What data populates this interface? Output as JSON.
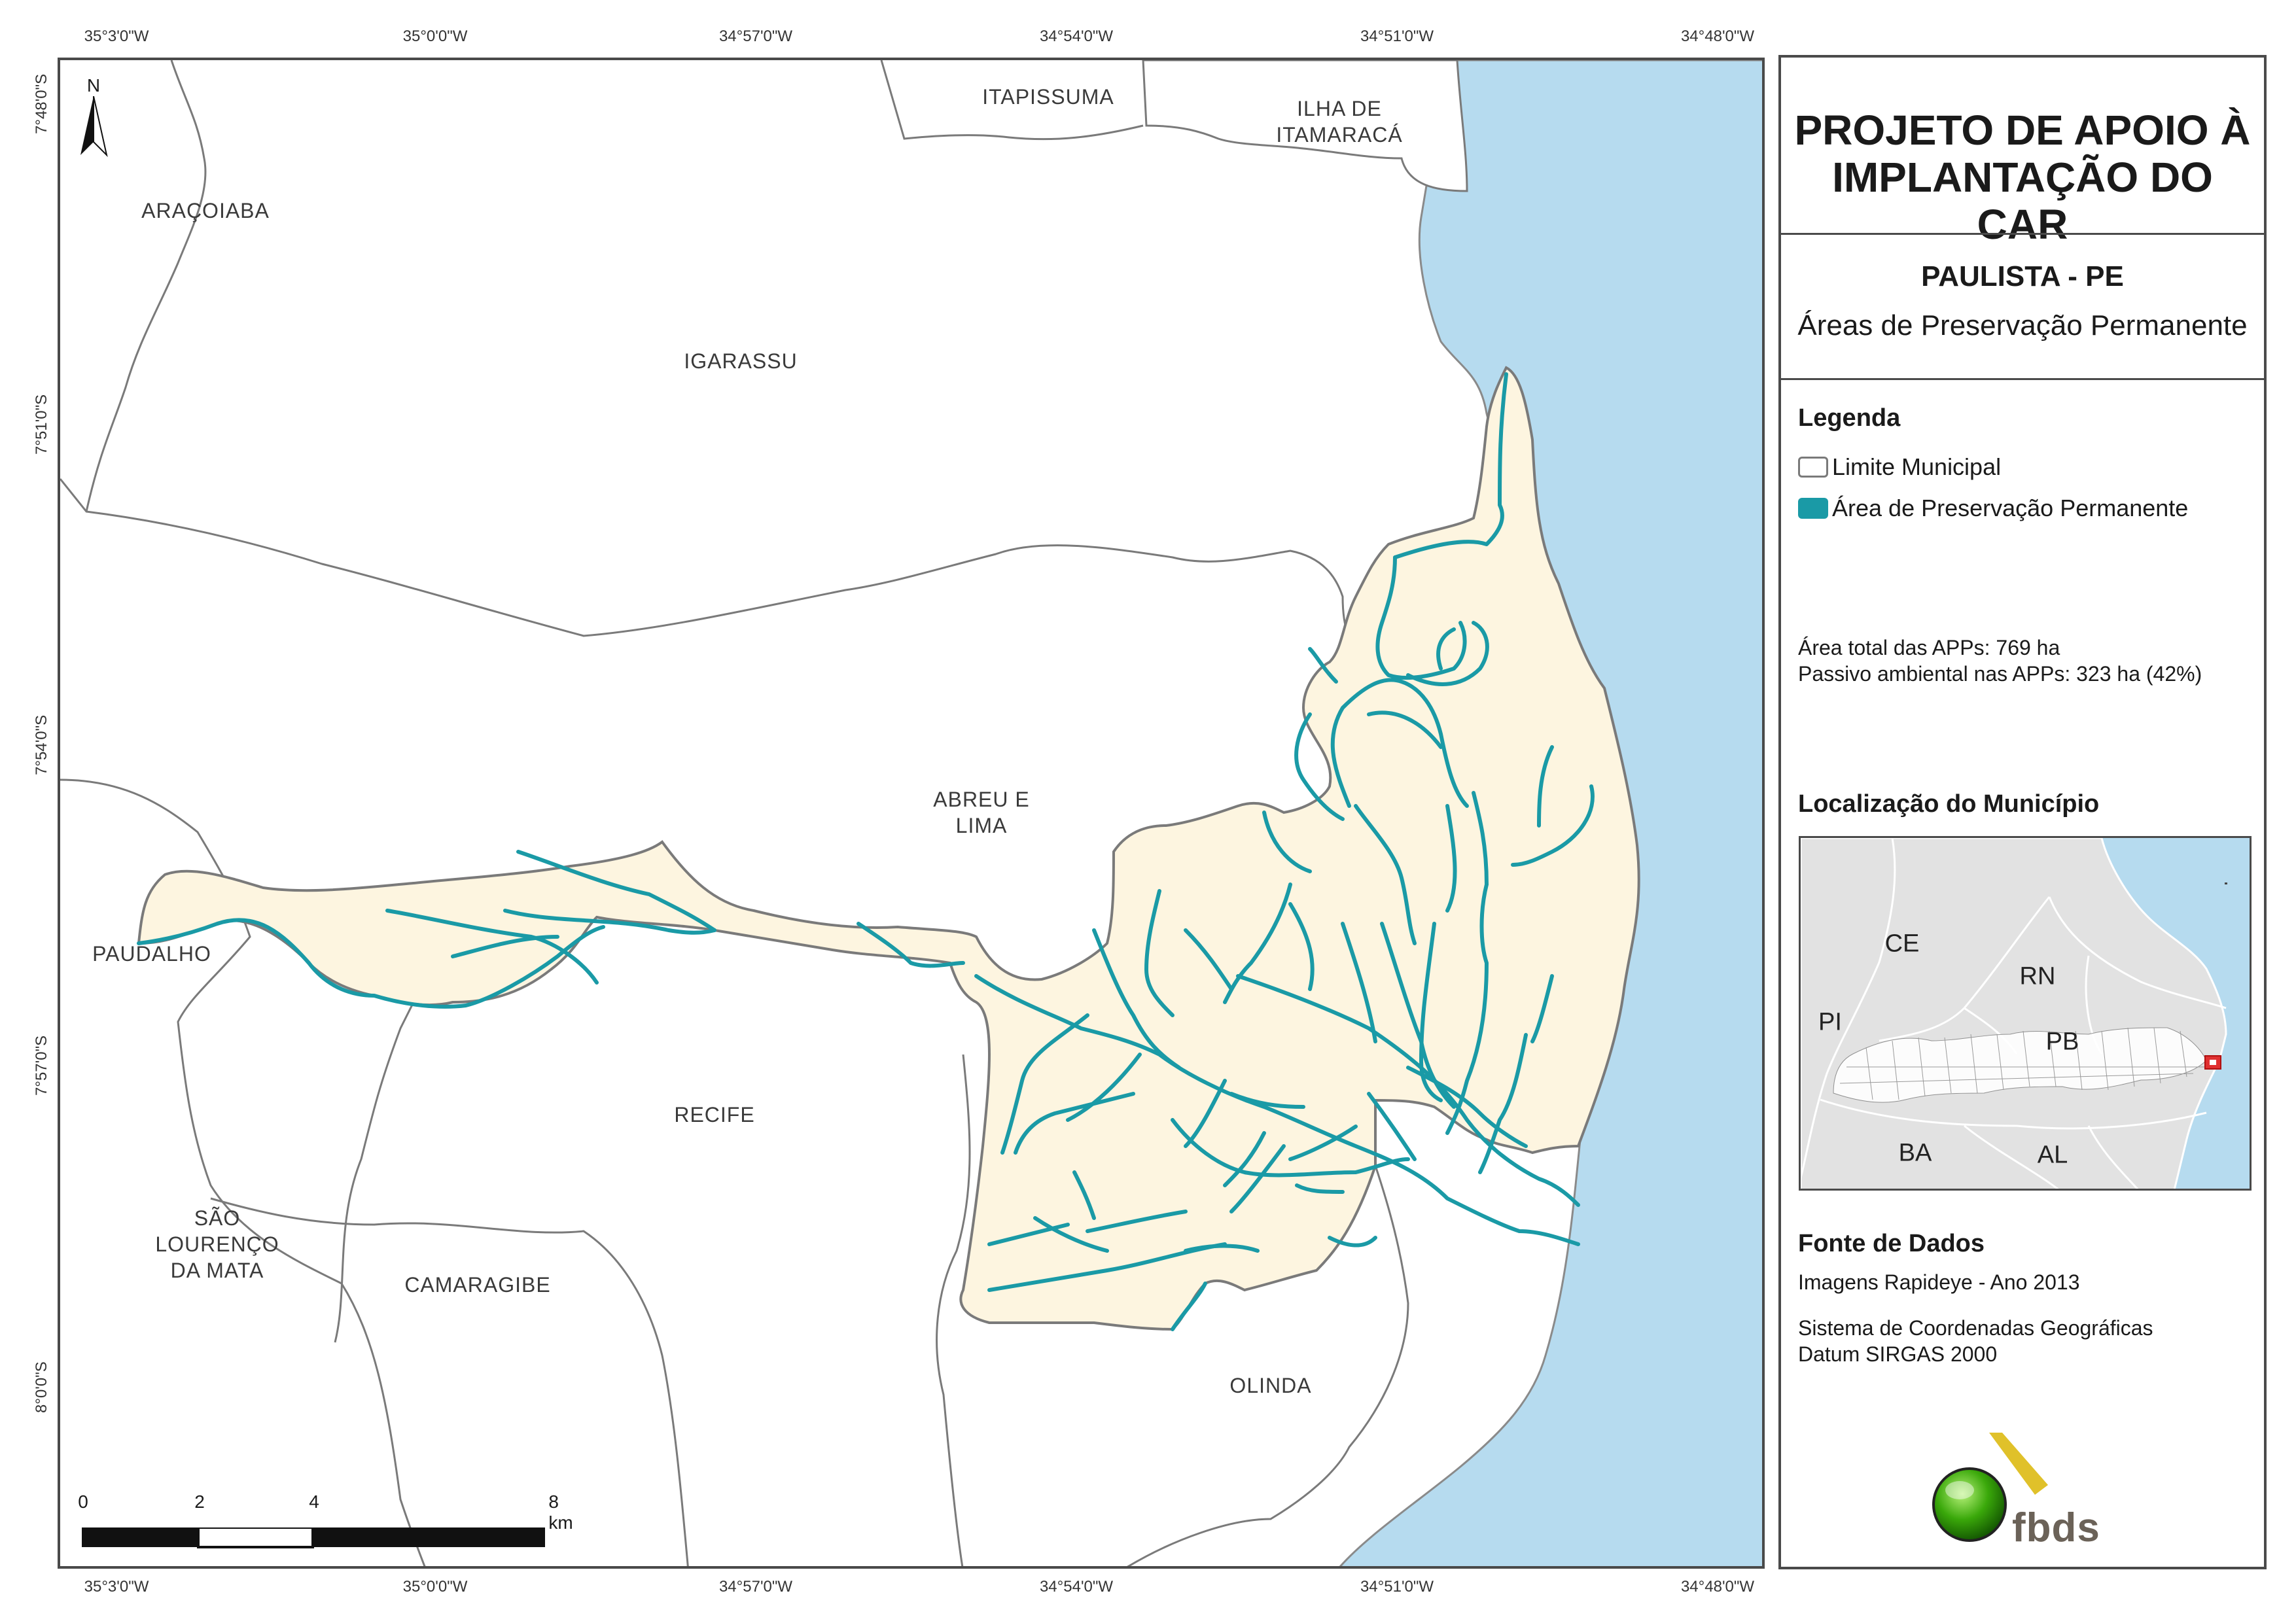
{
  "colors": {
    "sea": "#b6dbef",
    "municipality_fill": "#fdf5e0",
    "app_line": "#1a9aa6",
    "border": "#7a7a7a",
    "inset_land": "#e2e2e2"
  },
  "grid": {
    "top_labels": [
      "35°3'0\"W",
      "35°0'0\"W",
      "34°57'0\"W",
      "34°54'0\"W",
      "34°51'0\"W",
      "34°48'0\"W"
    ],
    "bottom_labels": [
      "35°3'0\"W",
      "35°0'0\"W",
      "34°57'0\"W",
      "34°54'0\"W",
      "34°51'0\"W",
      "34°48'0\"W"
    ],
    "left_labels": [
      "7°48'0\"S",
      "7°51'0\"S",
      "7°54'0\"S",
      "7°57'0\"S",
      "8°0'0\"S"
    ]
  },
  "north_arrow": {
    "label": "N",
    "icon": "north-arrow-icon"
  },
  "municipalities": {
    "itapissuma": "ITAPISSUMA",
    "ilha_de_itamaraca": "ILHA DE\nITAMARACÁ",
    "aracoiaba": "ARAÇOIABA",
    "igarassu": "IGARASSU",
    "abreu_e_lima": "ABREU E\nLIMA",
    "paudalho": "PAUDALHO",
    "recife": "RECIFE",
    "sao_lourenco_da_mata": "SÃO\nLOURENÇO\nDA MATA",
    "camaragibe": "CAMARAGIBE",
    "olinda": "OLINDA"
  },
  "scale_bar": {
    "ticks": [
      "0",
      "2",
      "4",
      "8 km"
    ]
  },
  "panel": {
    "title": "PROJETO DE APOIO À\nIMPLANTAÇÃO DO CAR",
    "municipality_title": "PAULISTA - PE",
    "map_theme": "Áreas de Preservação Permanente",
    "legend_heading": "Legenda",
    "legend_items": [
      {
        "label": "Limite Municipal",
        "color": "#ffffff"
      },
      {
        "label": "Área de Preservação Permanente",
        "color": "#1a9aa6"
      }
    ],
    "stats": [
      "Área total das APPs: 769 ha",
      "Passivo ambiental nas APPs: 323 ha (42%)"
    ],
    "location_heading": "Localização do Município",
    "inset_states": [
      "CE",
      "RN",
      "PI",
      "PB",
      "BA",
      "AL"
    ],
    "source_heading": "Fonte de Dados",
    "source_lines": [
      "Imagens Rapideye - Ano 2013",
      "Sistema de Coordenadas Geográficas",
      "Datum SIRGAS 2000"
    ],
    "logo_text": "fbds"
  }
}
